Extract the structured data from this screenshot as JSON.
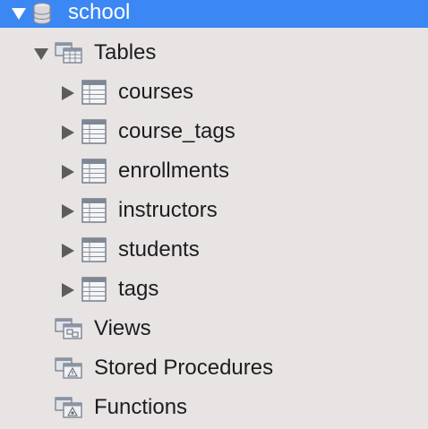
{
  "schema": {
    "name": "school",
    "expanded": true,
    "icon": "database-icon"
  },
  "tables_folder": {
    "label": "Tables",
    "expanded": true,
    "icon": "tables-folder-icon",
    "items": [
      {
        "label": "courses",
        "icon": "table-icon"
      },
      {
        "label": "course_tags",
        "icon": "table-icon"
      },
      {
        "label": "enrollments",
        "icon": "table-icon"
      },
      {
        "label": "instructors",
        "icon": "table-icon"
      },
      {
        "label": "students",
        "icon": "table-icon"
      },
      {
        "label": "tags",
        "icon": "table-icon"
      }
    ]
  },
  "other_folders": [
    {
      "label": "Views",
      "icon": "views-folder-icon"
    },
    {
      "label": "Stored Procedures",
      "icon": "procedures-folder-icon"
    },
    {
      "label": "Functions",
      "icon": "functions-folder-icon"
    }
  ],
  "colors": {
    "selection": "#3b87f3",
    "background": "#e8e4e4"
  }
}
